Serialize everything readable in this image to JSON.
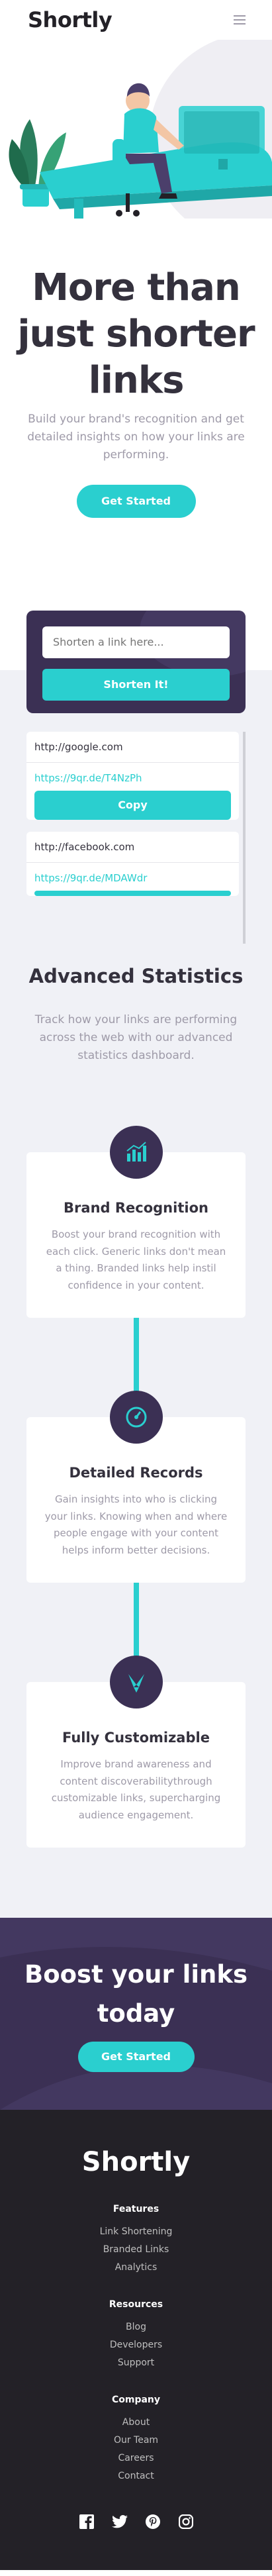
{
  "header": {
    "logo": "Shortly",
    "menu_icon": "hamburger-menu-icon"
  },
  "hero": {
    "title": "More than just shorter links",
    "subtitle": "Build your brand's recognition and get detailed insights on how your links are performing.",
    "cta_label": "Get Started"
  },
  "shorten": {
    "placeholder": "Shorten a link here...",
    "button_label": "Shorten It!",
    "results": [
      {
        "original": "http://google.com",
        "short": "https://9qr.de/T4NzPh",
        "copy_label": "Copy"
      },
      {
        "original": "http://facebook.com",
        "short": "https://9qr.de/MDAWdr",
        "copy_label": ""
      }
    ]
  },
  "stats": {
    "title": "Advanced Statistics",
    "subtitle": "Track how your links are performing across the web with our advanced statistics dashboard.",
    "features": [
      {
        "title": "Brand Recognition",
        "text": "Boost your brand recognition with each click. Generic links don't mean a thing. Branded links help instil confidence in your content.",
        "icon": "bar-chart-icon"
      },
      {
        "title": "Detailed Records",
        "text": "Gain insights into who is clicking your links. Knowing when and where people engage with your content helps inform better decisions.",
        "icon": "gauge-icon"
      },
      {
        "title": "Fully Customizable",
        "text": "Improve brand awareness and content discoverabilitythrough customizable links, supercharging audience engagement.",
        "icon": "brush-pen-icon"
      }
    ]
  },
  "boost": {
    "title": "Boost your links today",
    "cta_label": "Get Started"
  },
  "footer": {
    "logo": "Shortly",
    "columns": [
      {
        "heading": "Features",
        "links": [
          "Link Shortening",
          "Branded Links",
          "Analytics"
        ]
      },
      {
        "heading": "Resources",
        "links": [
          "Blog",
          "Developers",
          "Support"
        ]
      },
      {
        "heading": "Company",
        "links": [
          "About",
          "Our Team",
          "Careers",
          "Contact"
        ]
      }
    ],
    "social": [
      "facebook-icon",
      "twitter-icon",
      "pinterest-icon",
      "instagram-icon"
    ]
  },
  "colors": {
    "cyan": "#2acfcf",
    "dark_violet": "#3b3054",
    "very_dark_violet": "#232127",
    "gray": "#9e9aa8",
    "light_gray_bg": "#f0f1f6"
  }
}
